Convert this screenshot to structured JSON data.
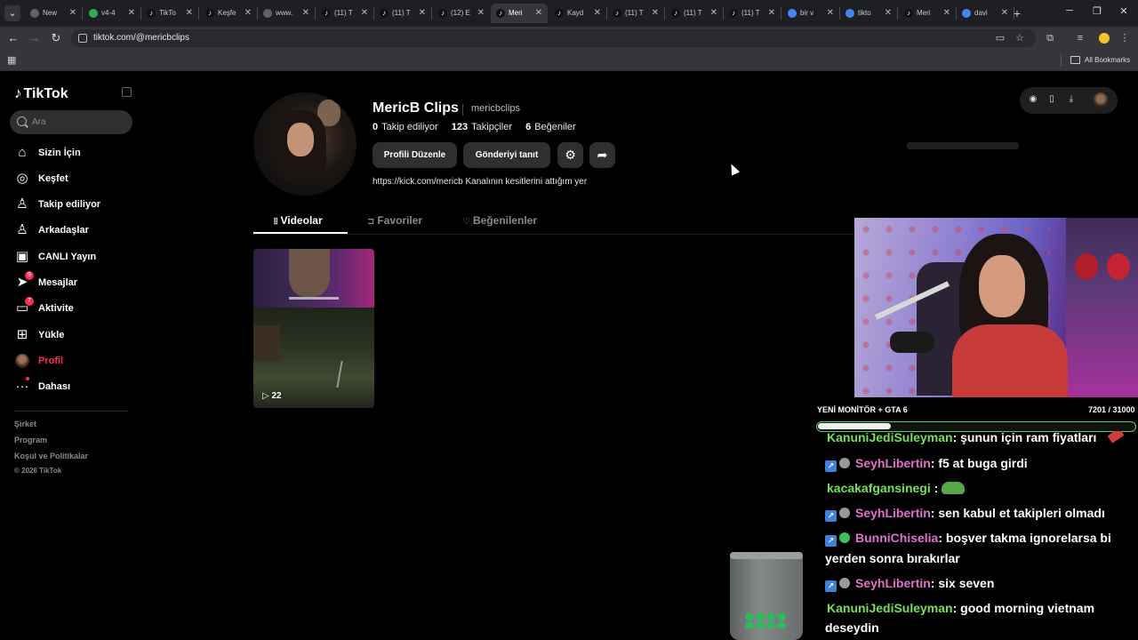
{
  "browser": {
    "tabs": [
      {
        "title": "New",
        "favicon": "chrome-icon",
        "color": "#5f6368",
        "active": false
      },
      {
        "title": "v4-4",
        "favicon": "green-globe-icon",
        "color": "#34a853",
        "active": false
      },
      {
        "title": "TikTo",
        "favicon": "tiktok-icon",
        "color": "#000000",
        "active": false
      },
      {
        "title": "Keşfe",
        "favicon": "tiktok-icon",
        "color": "#000000",
        "active": false
      },
      {
        "title": "www.",
        "favicon": "globe-icon",
        "color": "#5f6368",
        "active": false
      },
      {
        "title": "(11) T",
        "favicon": "tiktok-icon",
        "color": "#000000",
        "active": false
      },
      {
        "title": "(11) T",
        "favicon": "tiktok-icon",
        "color": "#000000",
        "active": false
      },
      {
        "title": "(12) E",
        "favicon": "tiktok-icon",
        "color": "#000000",
        "active": false
      },
      {
        "title": "Meri",
        "favicon": "tiktok-icon",
        "color": "#000000",
        "active": true
      },
      {
        "title": "Kayd",
        "favicon": "tiktok-icon",
        "color": "#000000",
        "active": false
      },
      {
        "title": "(11) T",
        "favicon": "tiktok-icon",
        "color": "#000000",
        "active": false
      },
      {
        "title": "(11) T",
        "favicon": "tiktok-icon",
        "color": "#000000",
        "active": false
      },
      {
        "title": "(11) T",
        "favicon": "tiktok-icon",
        "color": "#000000",
        "active": false
      },
      {
        "title": "bir v",
        "favicon": "google-icon",
        "color": "#4285f4",
        "active": false
      },
      {
        "title": "tikto",
        "favicon": "google-icon",
        "color": "#4285f4",
        "active": false
      },
      {
        "title": "Meri",
        "favicon": "tiktok-icon",
        "color": "#000000",
        "active": false
      },
      {
        "title": "davi",
        "favicon": "google-icon",
        "color": "#4285f4",
        "active": false
      }
    ],
    "new_tab": "+",
    "url": "tiktok.com/@mericbclips",
    "bookmarks_label": "All Bookmarks"
  },
  "sidebar": {
    "logo": "TikTok",
    "search_placeholder": "Ara",
    "items": [
      {
        "label": "Sizin İçin",
        "icon": "home-icon",
        "glyph": "⌂",
        "badge": ""
      },
      {
        "label": "Keşfet",
        "icon": "compass-icon",
        "glyph": "◎",
        "badge": ""
      },
      {
        "label": "Takip ediliyor",
        "icon": "person-icon",
        "glyph": "♙",
        "badge": ""
      },
      {
        "label": "Arkadaşlar",
        "icon": "friends-icon",
        "glyph": "♙",
        "badge": ""
      },
      {
        "label": "CANLI Yayın",
        "icon": "live-tv-icon",
        "glyph": "▣",
        "badge": ""
      },
      {
        "label": "Mesajlar",
        "icon": "paper-plane-icon",
        "glyph": "➤",
        "badge": "9"
      },
      {
        "label": "Aktivite",
        "icon": "chat-bubble-icon",
        "glyph": "▭",
        "badge": "7"
      },
      {
        "label": "Yükle",
        "icon": "plus-square-icon",
        "glyph": "⊞",
        "badge": ""
      },
      {
        "label": "Profil",
        "icon": "avatar-icon",
        "glyph": "",
        "badge": ""
      },
      {
        "label": "Dahası",
        "icon": "more-icon",
        "glyph": "···",
        "badge": "dot"
      }
    ],
    "footer": {
      "links": [
        "Şirket",
        "Program",
        "Koşul ve Politikalar"
      ],
      "copyright": "© 2026 TikTok"
    }
  },
  "profile": {
    "name": "MericB Clips",
    "handle": "mericbclips",
    "stats": [
      {
        "value": "0",
        "label": "Takip ediliyor"
      },
      {
        "value": "123",
        "label": "Takipçiler"
      },
      {
        "value": "6",
        "label": "Beğeniler"
      }
    ],
    "edit_button": "Profili Düzenle",
    "promote_button": "Gönderiyi tanıt",
    "bio": "https://kick.com/mericb Kanalının kesitlerini attığım yer",
    "tabs": [
      {
        "label": "Videolar",
        "icon": "grid-icon",
        "glyph": "⦙⦙",
        "active": true
      },
      {
        "label": "Favoriler",
        "icon": "bookmark-icon",
        "glyph": "⊐",
        "active": false
      },
      {
        "label": "Beğenilenler",
        "icon": "heart-icon",
        "glyph": "♡",
        "active": false
      }
    ],
    "videos": [
      {
        "views": "22",
        "play_glyph": "▷"
      }
    ]
  },
  "overlay": {
    "goal_label": "YENİ MONİTÖR + GTA 6",
    "goal_count": "7201 / 31000",
    "goal_progress": 0.232,
    "chat": [
      {
        "user": "KanuniJediSuleyman",
        "color": "#76e05a",
        "msg": ": şunun için ram fiyatları",
        "badges": false
      },
      {
        "user": "SeyhLibertin",
        "color": "#e070c8",
        "msg": ": f5 at buga girdi",
        "badges": true
      },
      {
        "user": "kacakafgansinegi",
        "color": "#76e05a",
        "msg": " :",
        "badges": false
      },
      {
        "user": "SeyhLibertin",
        "color": "#e070c8",
        "msg": ": sen kabul et takipleri olmadı",
        "badges": true
      },
      {
        "user": "BunniChiselia",
        "color": "#e070c8",
        "msg": ": boşver takma ignorelarsa bi",
        "badges": true
      },
      {
        "cont": "yerden sonra bırakırlar"
      },
      {
        "user": "SeyhLibertin",
        "color": "#e070c8",
        "msg": ": six seven",
        "badges": true
      },
      {
        "user": "KanuniJediSuleyman",
        "color": "#76e05a",
        "msg": ": good morning vietnam",
        "badges": false
      },
      {
        "cont": "deseydin"
      }
    ]
  }
}
